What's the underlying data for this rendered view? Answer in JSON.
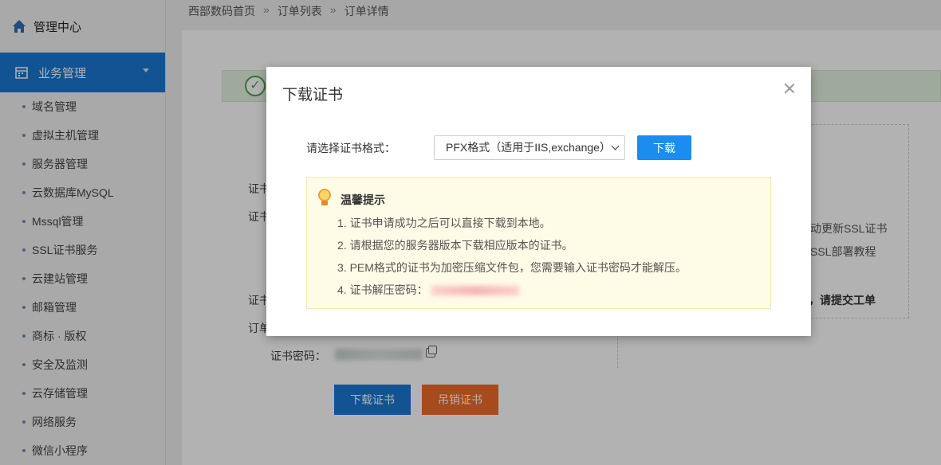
{
  "sidebar": {
    "top_label": "管理中心",
    "active_label": "业务管理",
    "items": [
      {
        "label": "域名管理"
      },
      {
        "label": "虚拟主机管理"
      },
      {
        "label": "服务器管理"
      },
      {
        "label": "云数据库MySQL"
      },
      {
        "label": "Mssql管理"
      },
      {
        "label": "SSL证书服务"
      },
      {
        "label": "云建站管理"
      },
      {
        "label": "邮箱管理"
      },
      {
        "label": "商标 · 版权"
      },
      {
        "label": "安全及监测"
      },
      {
        "label": "云存储管理"
      },
      {
        "label": "网络服务"
      },
      {
        "label": "微信小程序"
      }
    ]
  },
  "breadcrumb": {
    "home": "西部数码首页",
    "orders": "订单列表",
    "detail": "订单详情",
    "separator": "»"
  },
  "main": {
    "label_cert1": "证书",
    "label_cert2": "证书",
    "label_cert3": "证书",
    "label_order": "订单",
    "cert_password_label": "证书密码：",
    "right_line1": "动更新SSL证书",
    "right_line2": "SSL部署教程",
    "right_line3": "，请提交工单",
    "download_button": "下载证书",
    "revoke_button": "吊销证书"
  },
  "modal": {
    "title": "下载证书",
    "format_label": "请选择证书格式：",
    "format_selected": "PFX格式（适用于IIS,exchange）",
    "download_button": "下载",
    "tips_title": "温馨提示",
    "tips": [
      "1. 证书申请成功之后可以直接下载到本地。",
      "2. 请根据您的服务器版本下载相应版本的证书。",
      "3. PEM格式的证书为加密压缩文件包，您需要输入证书密码才能解压。",
      "4. 证书解压密码："
    ]
  },
  "icons": {
    "home": "home-icon",
    "calendar": "calendar-icon",
    "success": "check-circle-icon",
    "copy": "copy-icon",
    "close": "close-icon",
    "bulb": "lightbulb-icon"
  },
  "colors": {
    "primary": "#1b78d4",
    "danger": "#ef6a2b",
    "success": "#4aa84a",
    "tips_bg": "#fefbe6"
  }
}
